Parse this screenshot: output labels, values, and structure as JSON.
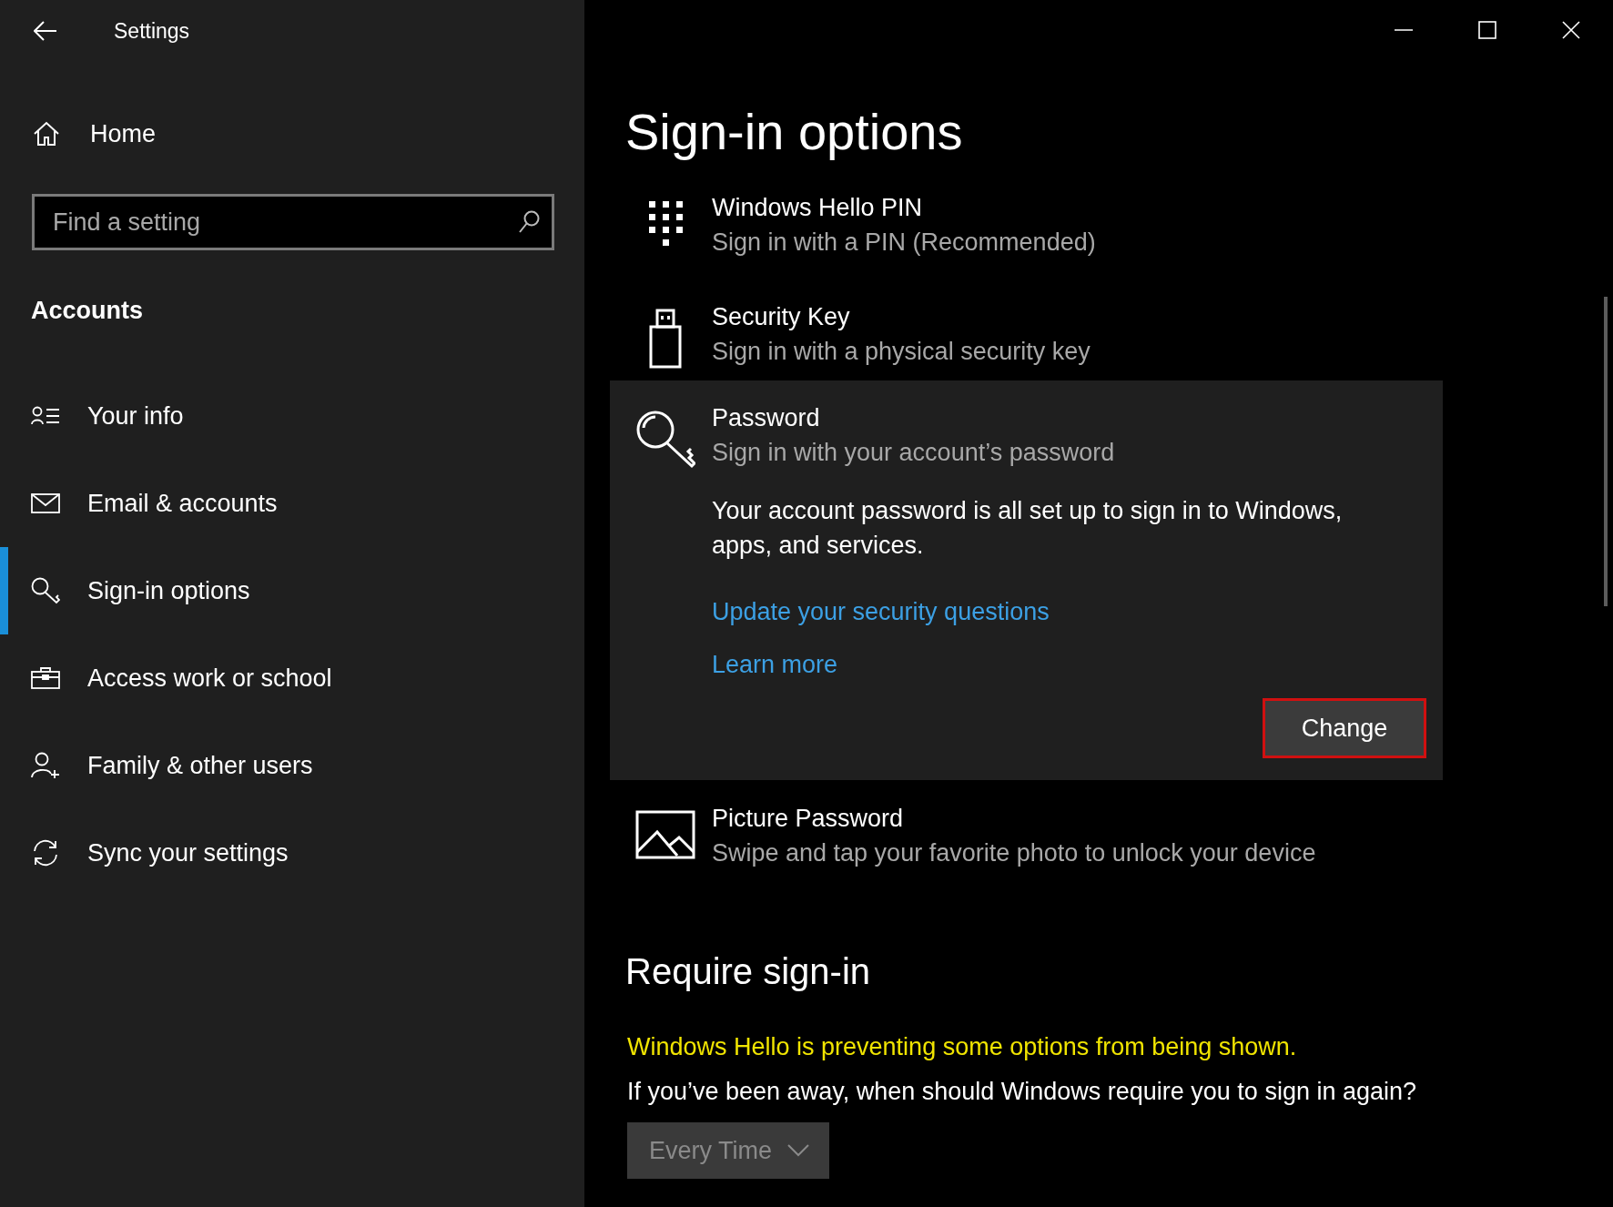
{
  "window": {
    "title": "Settings"
  },
  "sidebar": {
    "home": "Home",
    "search": {
      "placeholder": "Find a setting"
    },
    "section": "Accounts",
    "items": [
      {
        "label": "Your info",
        "selected": false
      },
      {
        "label": "Email & accounts",
        "selected": false
      },
      {
        "label": "Sign-in options",
        "selected": true
      },
      {
        "label": "Access work or school",
        "selected": false
      },
      {
        "label": "Family & other users",
        "selected": false
      },
      {
        "label": "Sync your settings",
        "selected": false
      }
    ]
  },
  "main": {
    "title": "Sign-in options",
    "options": [
      {
        "title": "Windows Hello PIN",
        "subtitle": "Sign in with a PIN (Recommended)",
        "expanded": false
      },
      {
        "title": "Security Key",
        "subtitle": "Sign in with a physical security key",
        "expanded": false
      },
      {
        "title": "Password",
        "subtitle": "Sign in with your account’s password",
        "expanded": true,
        "description": "Your account password is all set up to sign in to Windows, apps, and services.",
        "links": [
          "Update your security questions",
          "Learn more"
        ],
        "button": {
          "label": "Change",
          "highlighted": true
        }
      },
      {
        "title": "Picture Password",
        "subtitle": "Swipe and tap your favorite photo to unlock your device",
        "expanded": false
      }
    ],
    "require": {
      "heading": "Require sign-in",
      "warning": "Windows Hello is preventing some options from being shown.",
      "question": "If you’ve been away, when should Windows require you to sign in again?",
      "dropdown": {
        "value": "Every Time",
        "disabled": true
      }
    }
  }
}
